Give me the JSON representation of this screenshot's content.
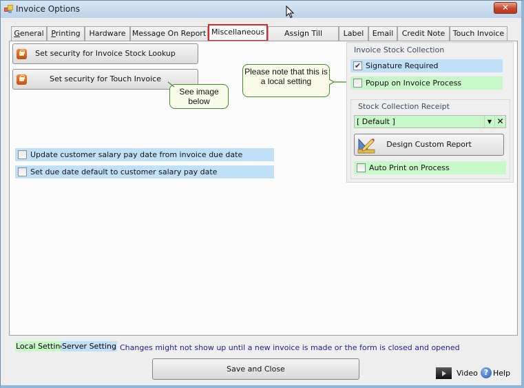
{
  "window": {
    "title": "Invoice Options",
    "close_label": "✕"
  },
  "tabs": [
    {
      "label": "General",
      "mnemonic": "G",
      "rest": "eneral"
    },
    {
      "label": "Printing",
      "mnemonic": "P",
      "rest": "rinting"
    },
    {
      "label": "Hardware"
    },
    {
      "label": "Message On Report"
    },
    {
      "label": "Miscellaneous",
      "active": true
    },
    {
      "label": "Assign Till Numbers"
    },
    {
      "label": "Label"
    },
    {
      "label": "Email"
    },
    {
      "label": "Credit Note"
    },
    {
      "label": "Touch Invoice"
    }
  ],
  "misc": {
    "security_buttons": [
      {
        "label": "Set security for Invoice Stock Lookup",
        "icon": "lock-icon"
      },
      {
        "label": "Set security for Touch Invoice",
        "icon": "lock-icon"
      }
    ],
    "callouts": {
      "see_image": "See image below",
      "local_note": "Please note that this is a local setting"
    },
    "server_options": [
      {
        "label": "Update customer salary pay date from invoice due date",
        "checked": false,
        "scope": "server"
      },
      {
        "label": "Set due date default to customer salary pay date",
        "checked": false,
        "scope": "server"
      }
    ],
    "stock_collection": {
      "title": "Invoice Stock Collection",
      "options": [
        {
          "label": "Signature Required",
          "checked": true,
          "scope": "server"
        },
        {
          "label": "Popup on Invoice Process",
          "checked": false,
          "scope": "local"
        }
      ],
      "receipt": {
        "title": "Stock Collection Receipt",
        "selected": "[ Default ]",
        "dropdown_icon": "▼",
        "clear_icon": "✕",
        "design_button": "Design Custom Report",
        "auto_print": {
          "label": "Auto Print on Process",
          "checked": false,
          "scope": "local"
        }
      }
    }
  },
  "footer": {
    "legend_local": "Local Setting",
    "legend_server": "Server Setting",
    "notice": "Changes might not show up until a new invoice is made or the form is closed and opened",
    "save_button": "Save and Close",
    "video_label": "Video",
    "help_label": "Help",
    "help_glyph": "?"
  },
  "colors": {
    "local": "#c7f8c7",
    "server": "#bfe0f7",
    "active_tab_border": "#d9252a",
    "callout_border": "#3f8a2e",
    "notice_text": "#1e1e8a"
  }
}
